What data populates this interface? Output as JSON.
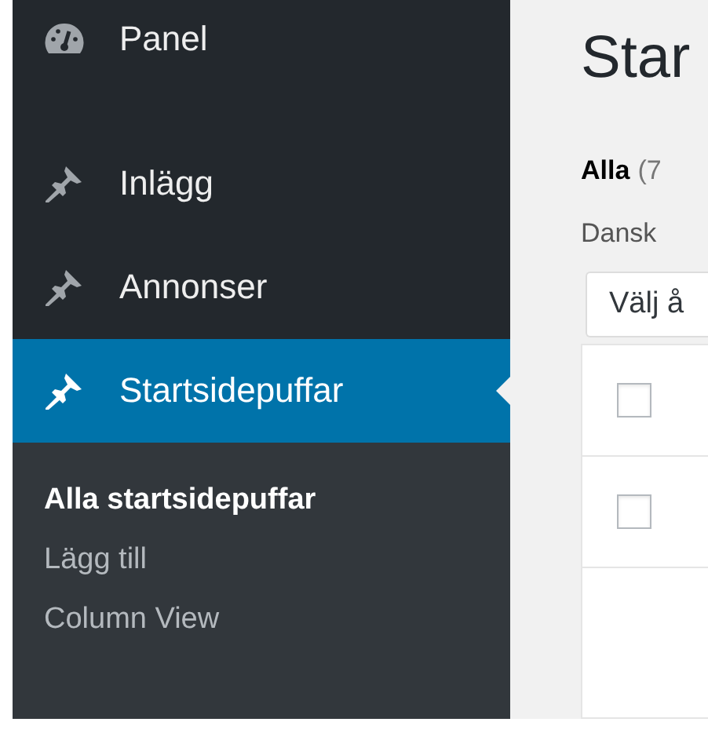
{
  "sidebar": {
    "items": [
      {
        "label": "Panel",
        "kind": "dashboard",
        "selected": false
      },
      {
        "label": "Inlägg",
        "kind": "post",
        "selected": false
      },
      {
        "label": "Annonser",
        "kind": "post",
        "selected": false
      },
      {
        "label": "Startsidepuffar",
        "kind": "post",
        "selected": true
      }
    ],
    "submenu": [
      {
        "label": "Alla startsidepuffar",
        "selected": true
      },
      {
        "label": "Lägg till",
        "selected": false
      },
      {
        "label": "Column View",
        "selected": false
      }
    ]
  },
  "content": {
    "title": "Star",
    "filter": {
      "label": "Alla",
      "count": "(7"
    },
    "language": "Dansk",
    "bulk_action": {
      "value": "Välj å"
    },
    "table": {
      "rows": [
        {
          "checked": false
        },
        {
          "checked": false
        }
      ]
    }
  }
}
